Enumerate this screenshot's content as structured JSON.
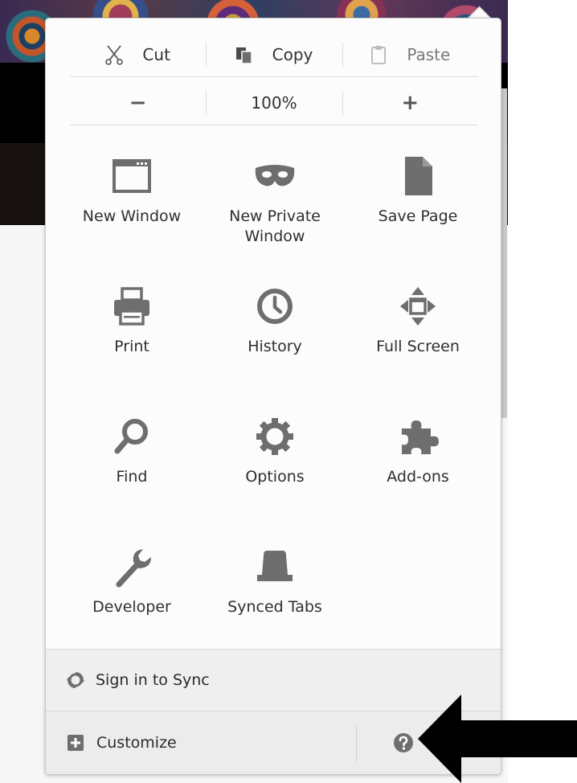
{
  "edit_controls": {
    "cut_label": "Cut",
    "copy_label": "Copy",
    "paste_label": "Paste",
    "icons": [
      "scissors-icon",
      "copy-icon",
      "paste-icon"
    ]
  },
  "zoom_controls": {
    "zoom_out_symbol": "−",
    "zoom_level": "100%",
    "zoom_in_symbol": "+"
  },
  "menu_items": [
    {
      "label": "New Window",
      "icon": "window-icon"
    },
    {
      "label": "New Private\nWindow",
      "icon": "mask-icon"
    },
    {
      "label": "Save Page",
      "icon": "page-icon"
    },
    {
      "label": "Print",
      "icon": "printer-icon"
    },
    {
      "label": "History",
      "icon": "clock-icon"
    },
    {
      "label": "Full Screen",
      "icon": "fullscreen-icon"
    },
    {
      "label": "Find",
      "icon": "magnifier-icon"
    },
    {
      "label": "Options",
      "icon": "gear-icon"
    },
    {
      "label": "Add-ons",
      "icon": "puzzle-icon"
    },
    {
      "label": "Developer",
      "icon": "wrench-icon"
    },
    {
      "label": "Synced Tabs",
      "icon": "synced-tabs-icon"
    }
  ],
  "footer": {
    "sync_label": "Sign in to Sync",
    "customize_label": "Customize",
    "help_icon": "help-icon"
  },
  "colors": {
    "icon_gray": "#6e6e6e",
    "panel_bg": "#fcfcfc",
    "footer_bg": "#ececec"
  }
}
